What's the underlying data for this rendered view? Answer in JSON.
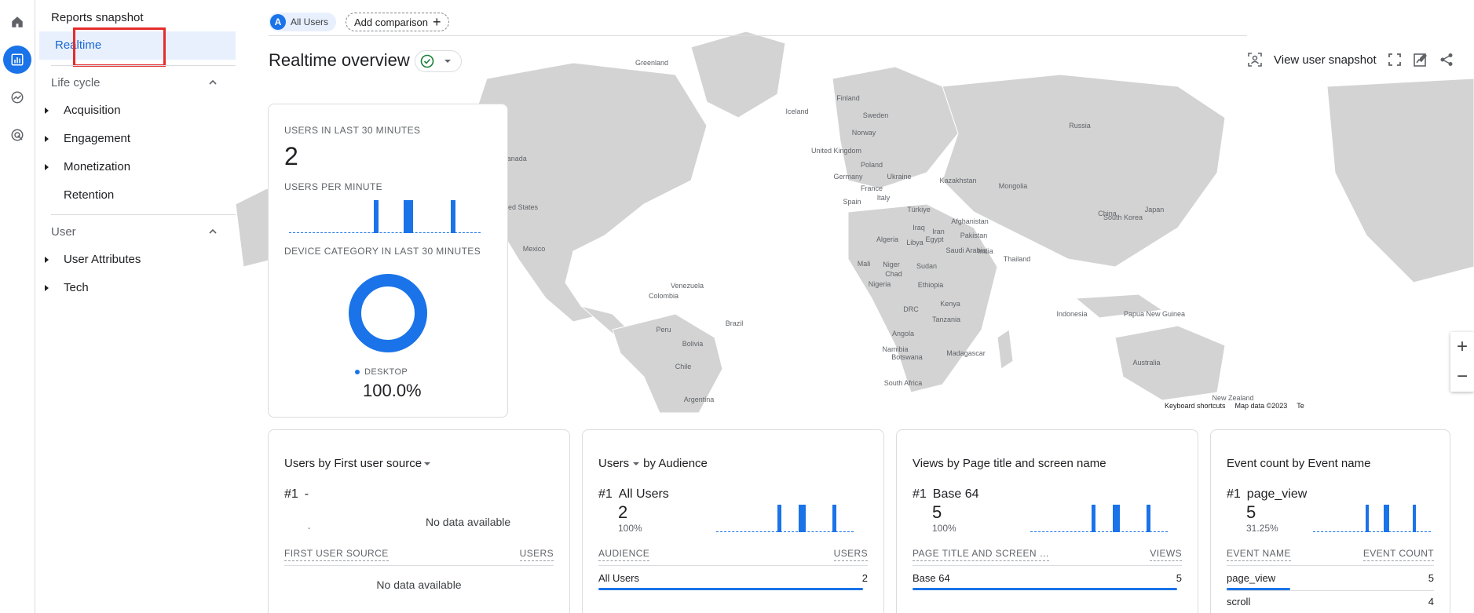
{
  "nav": {
    "reports_snapshot": "Reports snapshot",
    "realtime": "Realtime",
    "lifecycle": "Life cycle",
    "acquisition": "Acquisition",
    "engagement": "Engagement",
    "monetization": "Monetization",
    "retention": "Retention",
    "user": "User",
    "user_attributes": "User Attributes",
    "tech": "Tech"
  },
  "top": {
    "all_users_chip": "All Users",
    "chip_letter": "A",
    "add_comparison": "Add comparison",
    "title": "Realtime overview",
    "view_snapshot": "View user snapshot"
  },
  "map_labels": [
    "Greenland",
    "Iceland",
    "Finland",
    "Sweden",
    "Norway",
    "Russia",
    "United Kingdom",
    "Poland",
    "Germany",
    "Ukraine",
    "France",
    "Kazakhstan",
    "Mongolia",
    "Spain",
    "Italy",
    "Türkiye",
    "Japan",
    "South Korea",
    "China",
    "Iraq",
    "Iran",
    "Afghanistan",
    "Pakistan",
    "Algeria",
    "Libya",
    "Egypt",
    "Saudi Arabia",
    "India",
    "Thailand",
    "Mali",
    "Niger",
    "Chad",
    "Sudan",
    "Nigeria",
    "Ethiopia",
    "Kenya",
    "DRC",
    "Tanzania",
    "Angola",
    "Namibia",
    "Botswana",
    "Madagascar",
    "South Africa",
    "Indonesia",
    "Papua New Guinea",
    "Australia",
    "New Zealand",
    "Canada",
    "United States",
    "Mexico",
    "Venezuela",
    "Colombia",
    "Brazil",
    "Peru",
    "Bolivia",
    "Chile",
    "Argentina"
  ],
  "map_footer": {
    "shortcuts": "Keyboard shortcuts",
    "data": "Map data ©2023",
    "terms": "Te"
  },
  "overview_card": {
    "users_30_label": "USERS IN LAST 30 MINUTES",
    "users_30_value": "2",
    "users_per_min_label": "USERS PER MINUTE",
    "device_label": "DEVICE CATEGORY IN LAST 30 MINUTES",
    "legend_name": "DESKTOP",
    "legend_pct": "100.0%",
    "colors": {
      "accent": "#1a73e8"
    }
  },
  "cards": [
    {
      "title": "Users by First user source",
      "rank": "#1",
      "rank_name": "-",
      "sub_dash": "-",
      "no_data": "No data available",
      "col1": "FIRST USER SOURCE",
      "col2": "USERS",
      "table_no_data": "No data available"
    },
    {
      "title_a": "Users",
      "title_b": "by Audience",
      "rank": "#1",
      "rank_name": "All Users",
      "value": "2",
      "pct": "100%",
      "col1": "AUDIENCE",
      "col2": "USERS",
      "rows": [
        {
          "name": "All Users",
          "value": "2"
        }
      ]
    },
    {
      "title": "Views by Page title and screen name",
      "rank": "#1",
      "rank_name": "Base 64",
      "value": "5",
      "pct": "100%",
      "col1": "PAGE TITLE AND SCREEN …",
      "col2": "VIEWS",
      "rows": [
        {
          "name": "Base 64",
          "value": "5"
        }
      ]
    },
    {
      "title": "Event count by Event name",
      "rank": "#1",
      "rank_name": "page_view",
      "value": "5",
      "pct": "31.25%",
      "col1": "EVENT NAME",
      "col2": "EVENT COUNT",
      "rows": [
        {
          "name": "page_view",
          "value": "5"
        },
        {
          "name": "scroll",
          "value": "4"
        }
      ]
    }
  ],
  "chart_data": [
    {
      "type": "bar",
      "name": "users per minute",
      "values": [
        0,
        0,
        0,
        0,
        0,
        0,
        0,
        0,
        0,
        0,
        0,
        0,
        0,
        0,
        0,
        0,
        0,
        0,
        0,
        0,
        1,
        0,
        0,
        0,
        0,
        0,
        0,
        1,
        1,
        0,
        0,
        0,
        0,
        0,
        0,
        0,
        0,
        0,
        1,
        0,
        0,
        0,
        0,
        0,
        0
      ],
      "ylim": [
        0,
        1
      ]
    },
    {
      "type": "pie",
      "categories": [
        "DESKTOP"
      ],
      "values": [
        100.0
      ]
    }
  ]
}
